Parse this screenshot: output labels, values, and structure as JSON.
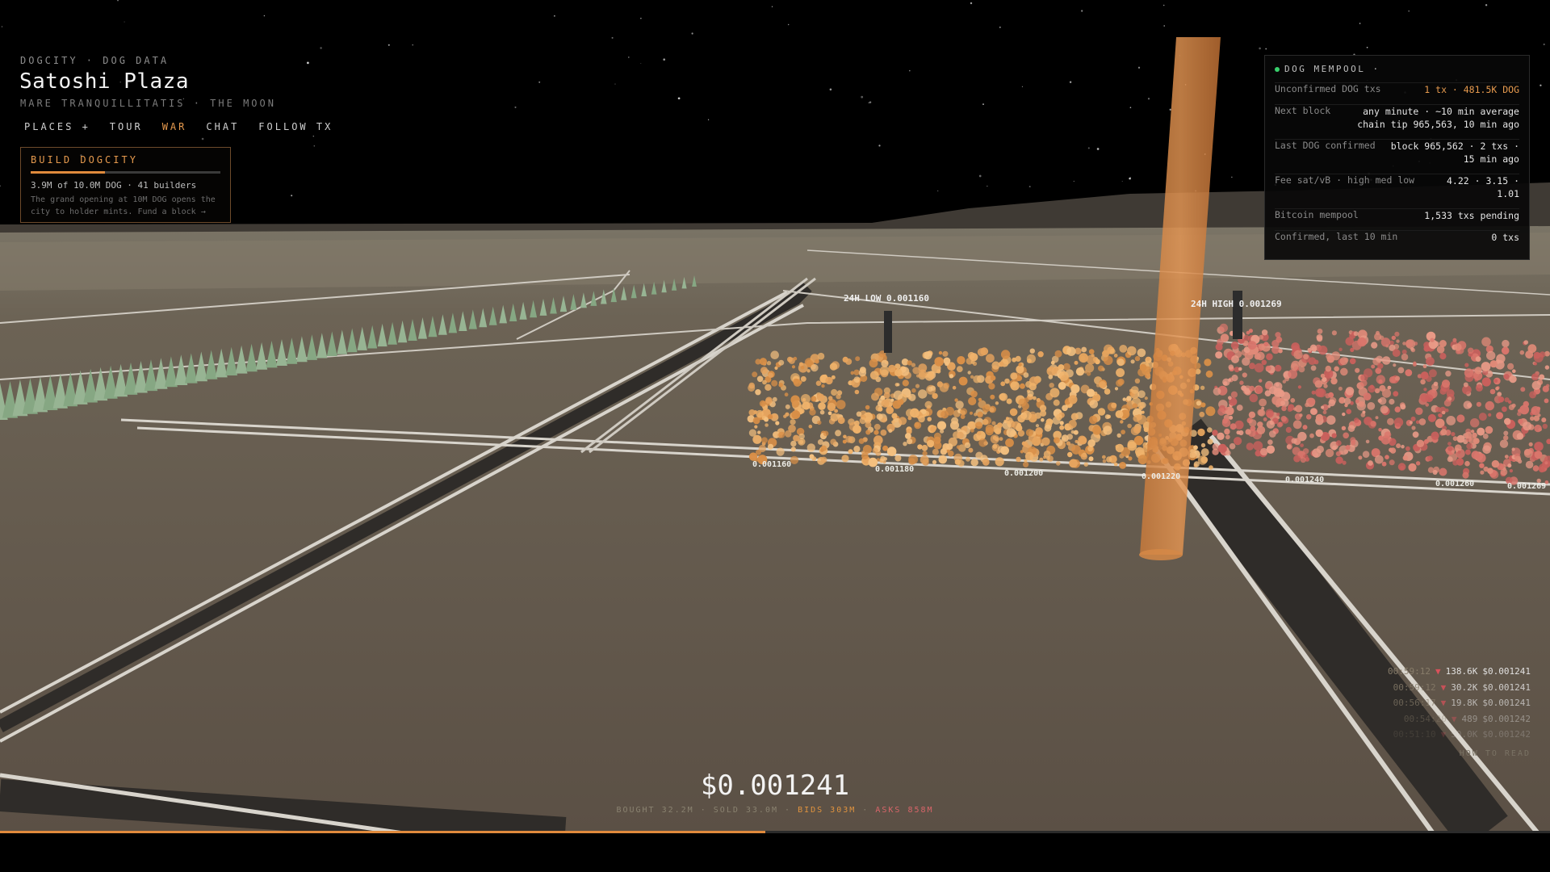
{
  "header": {
    "brand": "DOGCITY · DOG DATA",
    "title": "Satoshi Plaza",
    "subtitle": "MARE TRANQUILLITATIS · THE MOON"
  },
  "nav": [
    {
      "label": "PLACES +",
      "active": false
    },
    {
      "label": "TOUR",
      "active": false
    },
    {
      "label": "WAR",
      "active": true
    },
    {
      "label": "CHAT",
      "active": false
    },
    {
      "label": "FOLLOW TX",
      "active": false
    }
  ],
  "build": {
    "title": "BUILD DOGCITY",
    "progress_fraction": 0.39,
    "stat": "3.9M of 10.0M DOG · 41 builders",
    "note_line1": "The grand opening at 10M DOG opens the",
    "note_line2": "city to holder mints. Fund a block →"
  },
  "mempool": {
    "title": "DOG MEMPOOL ·",
    "status_color": "#38d06c",
    "rows": [
      {
        "key": "Unconfirmed DOG txs",
        "value": "1 tx · 481.5K DOG",
        "value2": "",
        "highlight": true
      },
      {
        "key": "Next block",
        "value": "any minute · ~10 min average",
        "value2": "chain tip 965,563, 10 min ago",
        "highlight": false
      },
      {
        "key": "Last DOG confirmed",
        "value": "block 965,562 · 2 txs ·",
        "value2": "15 min ago",
        "highlight": false
      },
      {
        "key": "Fee sat/vB · high med low",
        "value": "4.22 · 3.15 ·",
        "value2": "1.01",
        "highlight": false
      },
      {
        "key": "Bitcoin mempool",
        "value": "1,533 txs pending",
        "value2": "",
        "highlight": false
      },
      {
        "key": "Confirmed, last 10 min",
        "value": "0 txs",
        "value2": "",
        "highlight": false
      }
    ]
  },
  "scene": {
    "low_label": "24H LOW 0.001160",
    "high_label": "24H HIGH 0.001269",
    "price_ticks": [
      "0.001160",
      "0.001180",
      "0.001200",
      "0.001220",
      "0.001240",
      "0.001260",
      "0.001269"
    ]
  },
  "ticker": {
    "price": "$0.001241",
    "bought": "BOUGHT 32.2M",
    "sold": "SOLD 33.0M",
    "bids": "BIDS 303M",
    "asks": "ASKS 858M"
  },
  "trades": [
    {
      "time": "00:59:12",
      "amount": "138.6K",
      "price": "$0.001241",
      "opacity": 0.95
    },
    {
      "time": "00:59:12",
      "amount": "30.2K",
      "price": "$0.001241",
      "opacity": 0.8
    },
    {
      "time": "00:56:17",
      "amount": "19.8K",
      "price": "$0.001241",
      "opacity": 0.65
    },
    {
      "time": "00:54:20",
      "amount": "489",
      "price": "$0.001242",
      "opacity": 0.4
    },
    {
      "time": "00:51:10",
      "amount": "50.0K",
      "price": "$0.001242",
      "opacity": 0.22
    }
  ],
  "how_to_read": "HOW TO READ",
  "price_progress_fraction": 0.494,
  "colors": {
    "accent": "#e69a4e",
    "bid": "#e0933f",
    "ask": "#d9656a",
    "ground": "#5f5448"
  }
}
